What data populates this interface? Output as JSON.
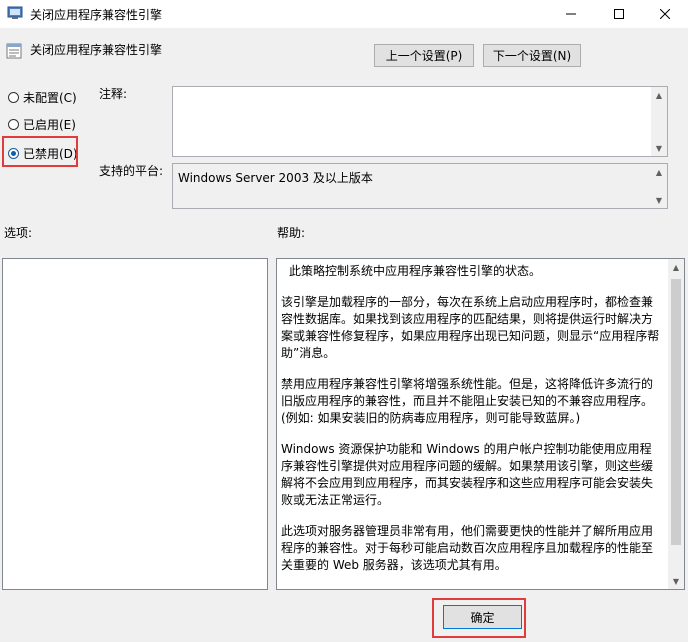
{
  "window": {
    "title": "关闭应用程序兼容性引擎"
  },
  "header": {
    "policy_title": "关闭应用程序兼容性引擎",
    "prev_label": "上一个设置(P)",
    "next_label": "下一个设置(N)"
  },
  "state": {
    "options": [
      {
        "label": "未配置(C)",
        "selected": false
      },
      {
        "label": "已启用(E)",
        "selected": false
      },
      {
        "label": "已禁用(D)",
        "selected": true
      }
    ]
  },
  "comment": {
    "label": "注释:",
    "value": ""
  },
  "platform": {
    "label": "支持的平台:",
    "value": "Windows Server 2003 及以上版本"
  },
  "options_pane": {
    "label": "选项:"
  },
  "help_pane": {
    "label": "帮助:",
    "paragraphs": [
      "此策略控制系统中应用程序兼容性引擎的状态。",
      "该引擎是加载程序的一部分，每次在系统上启动应用程序时，都检查兼容性数据库。如果找到该应用程序的匹配结果，则将提供运行时解决方案或兼容性修复程序，如果应用程序出现已知问题，则显示“应用程序帮助”消息。",
      "禁用应用程序兼容性引擎将增强系统性能。但是，这将降低许多流行的旧版应用程序的兼容性，而且并不能阻止安装已知的不兼容应用程序。(例如: 如果安装旧的防病毒应用程序，则可能导致蓝屏。)",
      "Windows 资源保护功能和 Windows 的用户帐户控制功能使用应用程序兼容性引擎提供对应用程序问题的缓解。如果禁用该引擎，则这些缓解将不会应用到应用程序，而其安装程序和这些应用程序可能会安装失败或无法正常运行。",
      "此选项对服务器管理员非常有用，他们需要更快的性能并了解所用应用程序的兼容性。对于每秒可能启动数百次应用程序且加载程序的性能至关重要的 Web 服务器，该选项尤其有用。"
    ]
  },
  "footer": {
    "ok_label": "确定"
  },
  "colors": {
    "highlight": "#e23b3b",
    "accent": "#0078d7"
  }
}
